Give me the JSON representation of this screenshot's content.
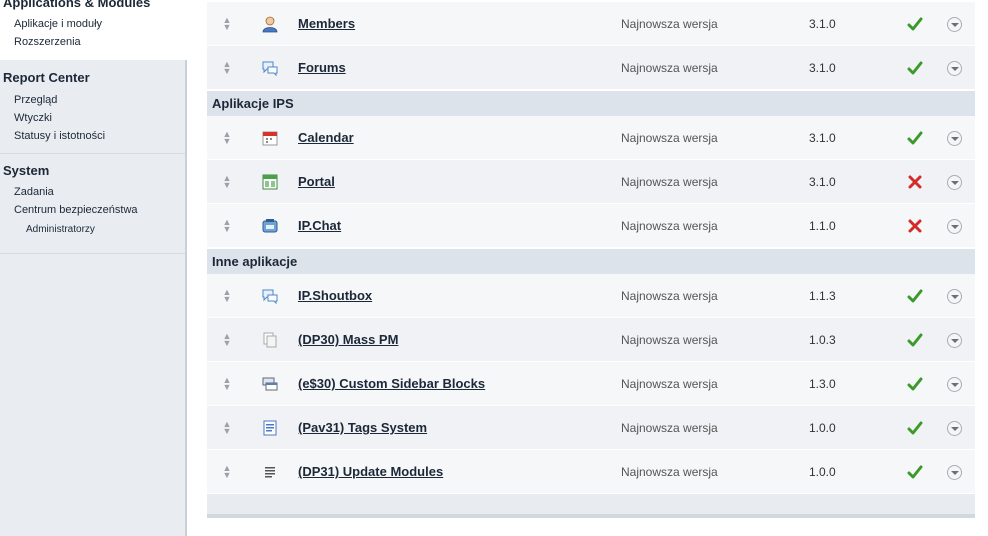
{
  "sidebar": {
    "applications": {
      "title": "Applications & Modules",
      "links": [
        "Aplikacje i moduły",
        "Rozszerzenia"
      ]
    },
    "report_center": {
      "title": "Report Center",
      "links": [
        "Przegląd",
        "Wtyczki",
        "Statusy i istotności"
      ]
    },
    "system": {
      "title": "System",
      "links": [
        "Zadania",
        "Centrum bezpieczeństwa"
      ],
      "sublinks": [
        "Administratorzy"
      ]
    }
  },
  "sections": {
    "ips": "Aplikacje IPS",
    "other": "Inne aplikacje"
  },
  "apps": [
    {
      "name": "Members",
      "status": "Najnowsza wersja",
      "version": "3.1.0",
      "enabled": true,
      "icon": "members-icon"
    },
    {
      "name": "Forums",
      "status": "Najnowsza wersja",
      "version": "3.1.0",
      "enabled": true,
      "icon": "forums-icon"
    },
    {
      "name": "Calendar",
      "status": "Najnowsza wersja",
      "version": "3.1.0",
      "enabled": true,
      "icon": "calendar-icon"
    },
    {
      "name": "Portal",
      "status": "Najnowsza wersja",
      "version": "3.1.0",
      "enabled": false,
      "icon": "portal-icon"
    },
    {
      "name": "IP.Chat",
      "status": "Najnowsza wersja",
      "version": "1.1.0",
      "enabled": false,
      "icon": "chat-icon"
    },
    {
      "name": "IP.Shoutbox",
      "status": "Najnowsza wersja",
      "version": "1.1.3",
      "enabled": true,
      "icon": "shoutbox-icon"
    },
    {
      "name": "(DP30) Mass PM",
      "status": "Najnowsza wersja",
      "version": "1.0.3",
      "enabled": true,
      "icon": "mass-pm-icon"
    },
    {
      "name": "(e$30) Custom Sidebar Blocks",
      "status": "Najnowsza wersja",
      "version": "1.3.0",
      "enabled": true,
      "icon": "sidebar-blocks-icon"
    },
    {
      "name": "(Pav31) Tags System",
      "status": "Najnowsza wersja",
      "version": "1.0.0",
      "enabled": true,
      "icon": "tags-icon"
    },
    {
      "name": "(DP31) Update Modules",
      "status": "Najnowsza wersja",
      "version": "1.0.0",
      "enabled": true,
      "icon": "update-modules-icon"
    }
  ],
  "colors": {
    "enabled": "#3c9a2a",
    "disabled": "#d42a2a",
    "section_bg": "#dde3ea"
  }
}
